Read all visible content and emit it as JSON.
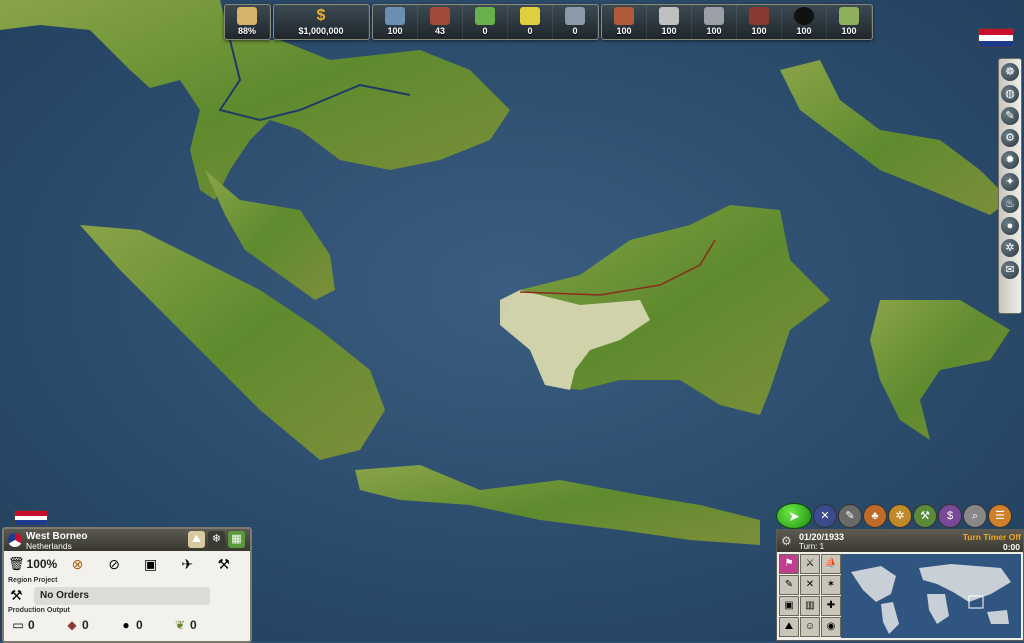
{
  "resources": {
    "approval": "88%",
    "money": "$1,000,000",
    "items": [
      "100",
      "43",
      "0",
      "0",
      "0"
    ],
    "goods": [
      "100",
      "100",
      "100",
      "100",
      "100",
      "100"
    ]
  },
  "province": {
    "name": "West Borneo",
    "owner": "Netherlands",
    "efficiency": "100%",
    "region_project_label": "Region Project",
    "orders": "No Orders",
    "production_output_label": "Production Output",
    "outputs": [
      "0",
      "0",
      "0",
      "0"
    ]
  },
  "turn": {
    "date": "01/20/1933",
    "turn_label": "Turn: 1",
    "timer_label": "Turn Timer Off",
    "timer_value": "0:00"
  },
  "colors": {
    "sea": "#2c4d6e",
    "land": "#6f8f36",
    "selected": "#d8d8b4",
    "accent_orange": "#f2a623"
  }
}
